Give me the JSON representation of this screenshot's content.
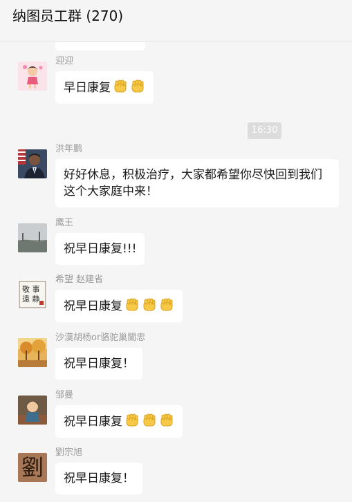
{
  "header": {
    "title": "纳图员工群 (270)"
  },
  "timestamp": "16:30",
  "messages": [
    {
      "sender": "迎迎",
      "text": "早日康复",
      "fists": [
        1,
        1
      ]
    },
    {
      "sender": "洪年鹏",
      "text": "好好休息，积极治疗，大家都希望你尽快回到我们这个大家庭中来！",
      "fists": []
    },
    {
      "sender": "鹰王",
      "text": "祝早日康复!!!",
      "fists": []
    },
    {
      "sender": "希望 赵建省",
      "text": "祝早日康复",
      "fists": [
        1,
        1,
        1
      ]
    },
    {
      "sender": "沙漠胡杨or骆驼巢閫忠",
      "text": "祝早日康复！",
      "fists": []
    },
    {
      "sender": "邹曼",
      "text": "祝早日康复",
      "fists": [
        1,
        1,
        1
      ]
    },
    {
      "sender": "劉宗旭",
      "text": "祝早日康复！",
      "fists": []
    }
  ],
  "avatar_glyphs": {
    "seal": "敬 事 遠 静",
    "liu": "劉"
  },
  "icons": {
    "fist": "fist-emoji-icon"
  },
  "colors": {
    "background": "#f5f5f5",
    "bubble": "#ffffff",
    "sender": "#9a9a9a",
    "time_pill": "#dcdcdc"
  }
}
